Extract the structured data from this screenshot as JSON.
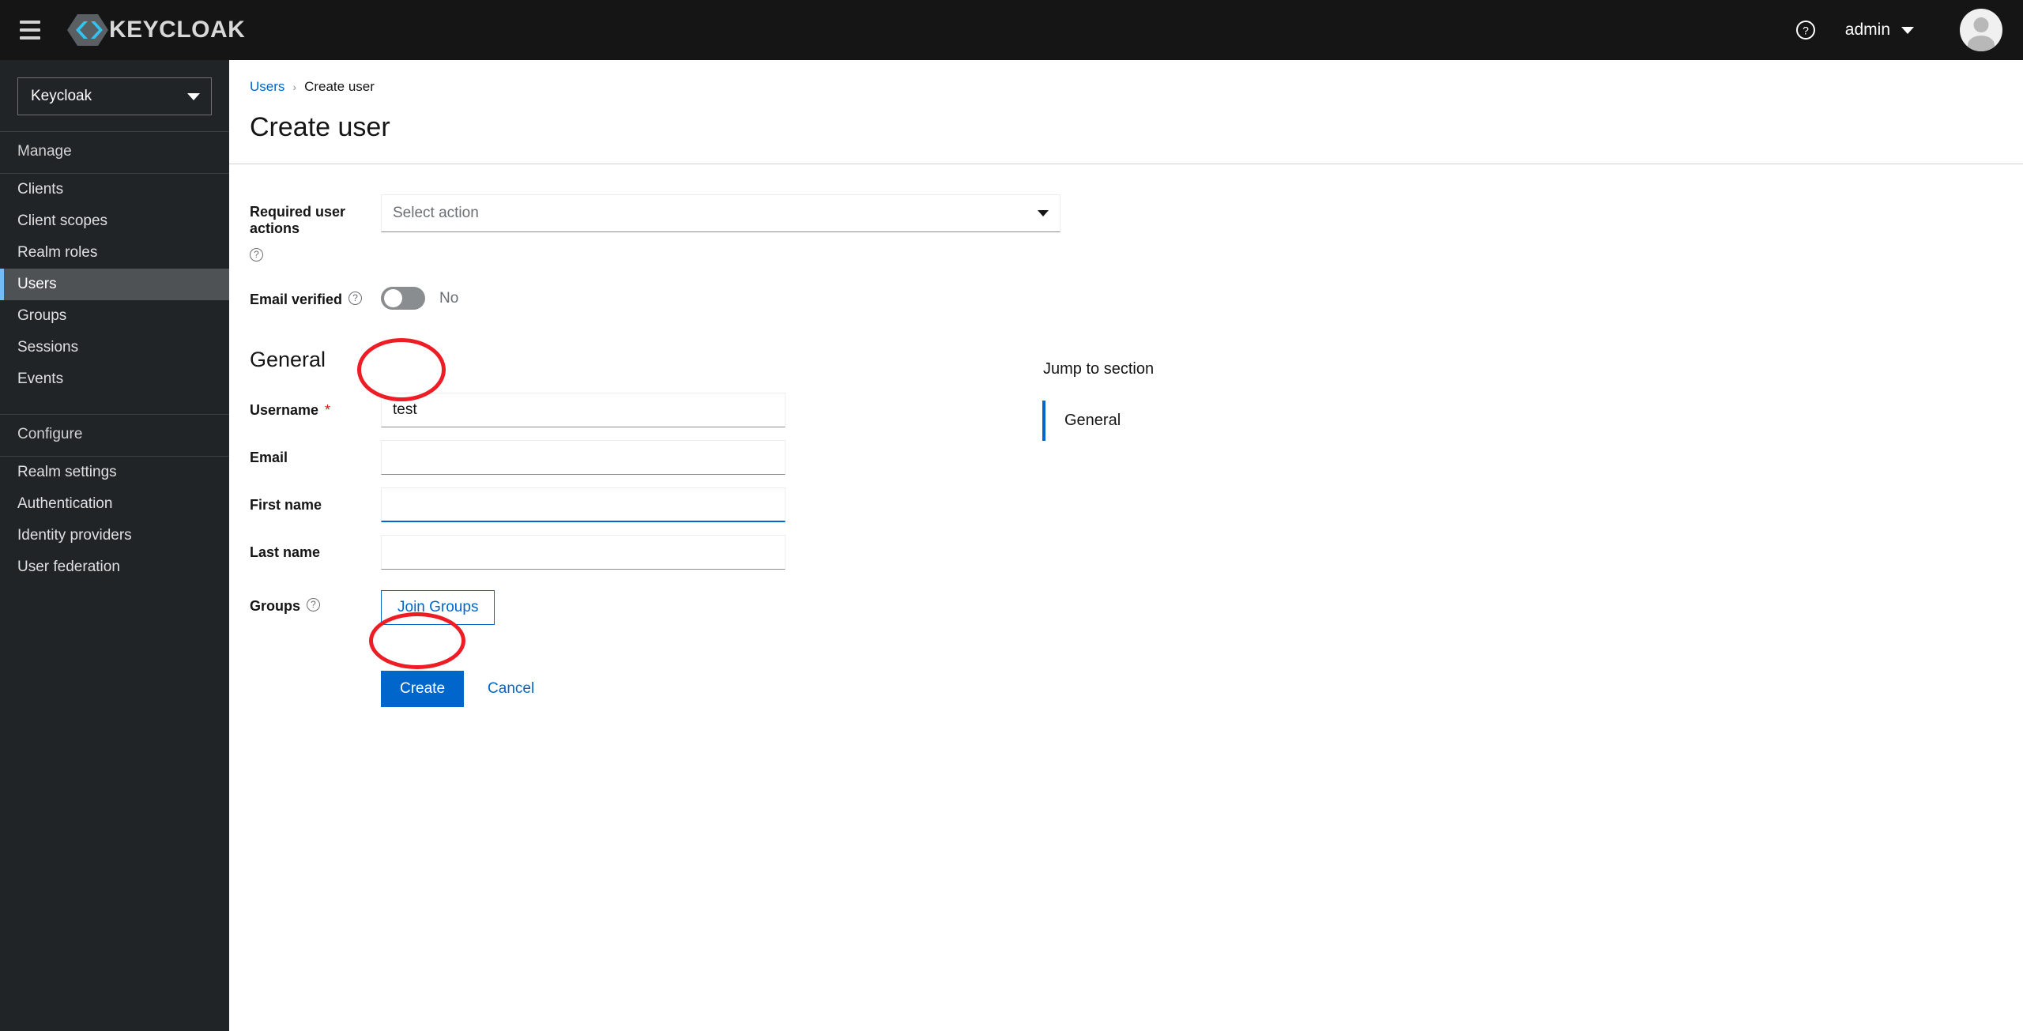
{
  "masthead": {
    "brand_text": "KEYCLOAK",
    "brand_icon": "keycloak-logo-icon",
    "menu_icon": "hamburger-menu-icon",
    "help_icon": "help-circle-icon",
    "user_name": "admin",
    "avatar_icon": "user-avatar-icon"
  },
  "sidebar": {
    "realm_selector": {
      "value": "Keycloak",
      "caret_icon": "chevron-down-icon"
    },
    "groups": [
      {
        "title": "Manage",
        "items": [
          {
            "label": "Clients",
            "active": false
          },
          {
            "label": "Client scopes",
            "active": false
          },
          {
            "label": "Realm roles",
            "active": false
          },
          {
            "label": "Users",
            "active": true
          },
          {
            "label": "Groups",
            "active": false
          },
          {
            "label": "Sessions",
            "active": false
          },
          {
            "label": "Events",
            "active": false
          }
        ]
      },
      {
        "title": "Configure",
        "items": [
          {
            "label": "Realm settings",
            "active": false
          },
          {
            "label": "Authentication",
            "active": false
          },
          {
            "label": "Identity providers",
            "active": false
          },
          {
            "label": "User federation",
            "active": false
          }
        ]
      }
    ]
  },
  "page": {
    "breadcrumb": {
      "parent": "Users",
      "separator": "›",
      "current": "Create user"
    },
    "title": "Create user"
  },
  "form": {
    "required_user_actions": {
      "label": "Required user actions",
      "help_icon": "help-circle-icon",
      "placeholder": "Select action",
      "value": "",
      "caret_icon": "chevron-down-icon"
    },
    "email_verified": {
      "label": "Email verified",
      "help_icon": "help-circle-icon",
      "state_text": "No",
      "checked": false
    },
    "general_section": {
      "heading": "General",
      "fields": [
        {
          "label": "Username",
          "required_marker": "*",
          "value": "test",
          "placeholder": "",
          "focused": false
        },
        {
          "label": "Email",
          "required_marker": "",
          "value": "",
          "placeholder": "",
          "focused": false
        },
        {
          "label": "First name",
          "required_marker": "",
          "value": "",
          "placeholder": "",
          "focused": true
        },
        {
          "label": "Last name",
          "required_marker": "",
          "value": "",
          "placeholder": "",
          "focused": false
        }
      ],
      "groups_field": {
        "label": "Groups",
        "help_icon": "help-circle-icon",
        "button_label": "Join Groups"
      }
    },
    "actions": {
      "submit_label": "Create",
      "cancel_label": "Cancel"
    }
  },
  "jump_to_section": {
    "title": "Jump to section",
    "items": [
      {
        "label": "General",
        "active": true
      }
    ]
  },
  "annotations": {
    "accent_color": "#ee1c25",
    "highlighted": [
      "username-input",
      "create-button"
    ]
  },
  "colors": {
    "masthead_bg": "#151515",
    "sidebar_bg": "#212427",
    "sidebar_active_bg": "#4f5255",
    "sidebar_active_accent": "#73bcf7",
    "link_blue": "#0066cc",
    "primary_button": "#0066cc",
    "required_red": "#c9190b",
    "annotation_red": "#ee1c25"
  }
}
